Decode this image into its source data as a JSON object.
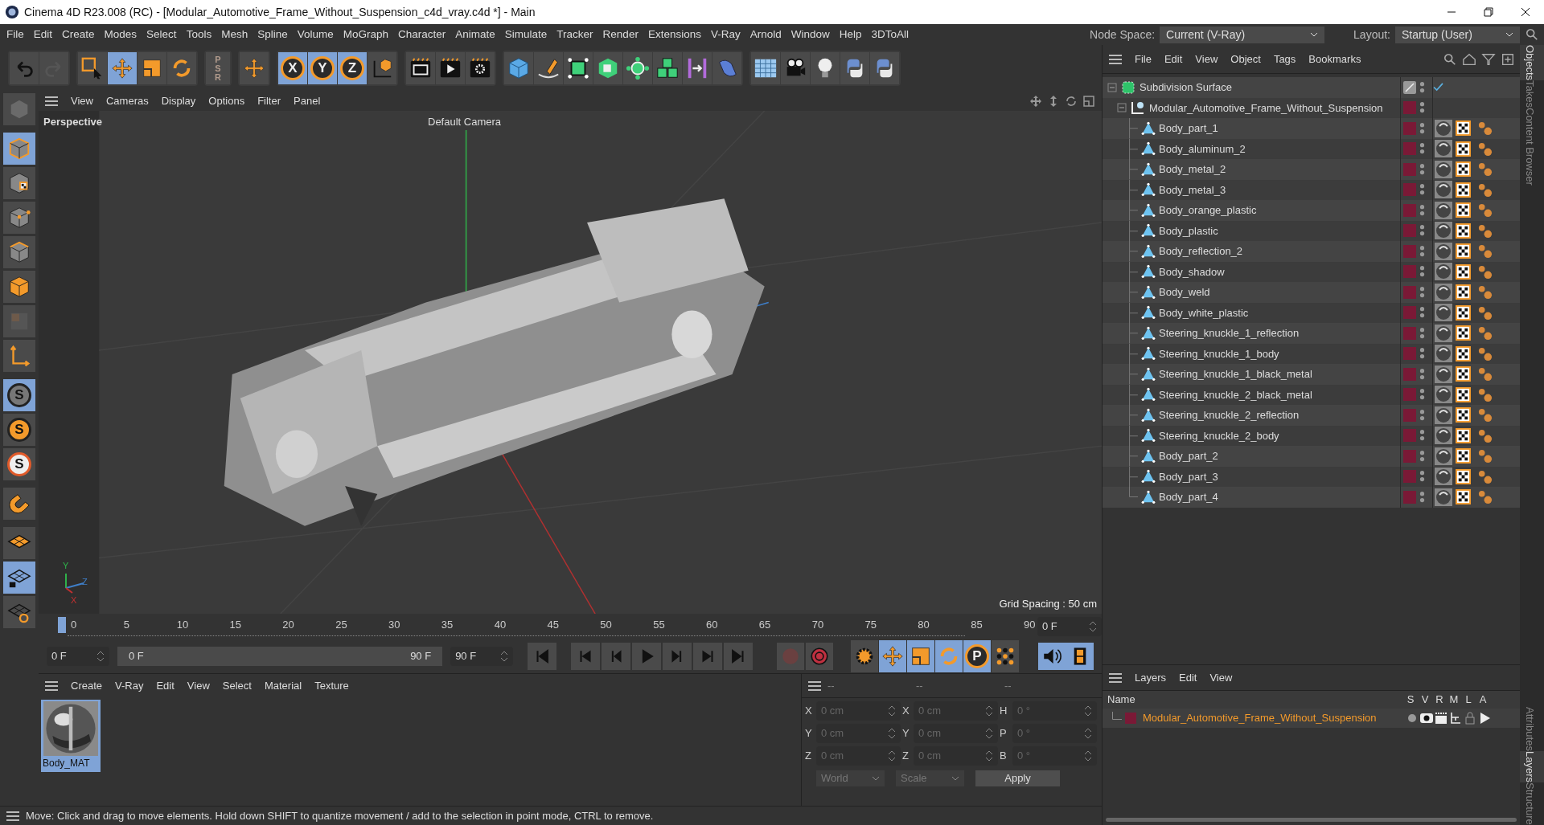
{
  "window": {
    "title": "Cinema 4D R23.008 (RC) - [Modular_Automotive_Frame_Without_Suspension_c4d_vray.c4d *] - Main"
  },
  "menu": [
    "File",
    "Edit",
    "Create",
    "Modes",
    "Select",
    "Tools",
    "Mesh",
    "Spline",
    "Volume",
    "MoGraph",
    "Character",
    "Animate",
    "Simulate",
    "Tracker",
    "Render",
    "Extensions",
    "V-Ray",
    "Arnold",
    "Window",
    "Help",
    "3DToAll"
  ],
  "node_space": {
    "label": "Node Space:",
    "value": "Current (V-Ray)"
  },
  "layout": {
    "label": "Layout:",
    "value": "Startup (User)"
  },
  "toolbar": [
    [
      {
        "kind": "undo",
        "selected": false
      },
      {
        "kind": "redo",
        "selected": false
      }
    ],
    [
      {
        "kind": "select",
        "selected": false
      },
      {
        "kind": "move",
        "selected": true
      },
      {
        "kind": "scale",
        "selected": false
      },
      {
        "kind": "rotate",
        "selected": false
      }
    ],
    [
      {
        "kind": "psr",
        "selected": false,
        "label": "PSR"
      }
    ],
    [
      {
        "kind": "move",
        "selected": false
      }
    ],
    [
      {
        "kind": "axis",
        "selected": true,
        "label": "X"
      },
      {
        "kind": "axis",
        "selected": true,
        "label": "Y"
      },
      {
        "kind": "axis",
        "selected": true,
        "label": "Z"
      },
      {
        "kind": "coord",
        "selected": false
      }
    ],
    [
      {
        "kind": "renderview",
        "selected": false
      },
      {
        "kind": "render",
        "selected": false
      },
      {
        "kind": "rendersettings",
        "selected": false
      }
    ],
    [
      {
        "kind": "cube",
        "selected": false
      },
      {
        "kind": "pen",
        "selected": false
      },
      {
        "kind": "subdivide",
        "selected": false
      },
      {
        "kind": "extrude",
        "selected": false
      },
      {
        "kind": "cloner",
        "selected": false
      },
      {
        "kind": "cubes",
        "selected": false
      },
      {
        "kind": "symmetry",
        "selected": false
      },
      {
        "kind": "deformer",
        "selected": false
      }
    ],
    [
      {
        "kind": "floor",
        "selected": false
      },
      {
        "kind": "camera",
        "selected": false
      },
      {
        "kind": "light",
        "selected": false
      },
      {
        "kind": "script",
        "selected": false
      },
      {
        "kind": "script",
        "selected": false
      }
    ]
  ],
  "left_tools": [
    {
      "kind": "model",
      "selected": false
    },
    {
      "kind": "object",
      "selected": true
    },
    {
      "kind": "texture",
      "selected": false
    },
    {
      "kind": "point",
      "selected": false
    },
    {
      "kind": "edge",
      "selected": false
    },
    {
      "kind": "polygon",
      "selected": false
    },
    {
      "kind": "uv",
      "selected": false
    },
    {
      "kind": "axis",
      "selected": false
    },
    {
      "kind": "snap",
      "selected": true,
      "label": "S"
    },
    {
      "kind": "snaporange",
      "selected": false,
      "label": "S"
    },
    {
      "kind": "snapwhite",
      "selected": false,
      "label": "S"
    },
    {
      "kind": "magnet",
      "selected": false
    },
    {
      "kind": "plane",
      "selected": false
    },
    {
      "kind": "planelock",
      "selected": true
    },
    {
      "kind": "planesync",
      "selected": false
    }
  ],
  "viewport": {
    "menu": [
      "View",
      "Cameras",
      "Display",
      "Options",
      "Filter",
      "Panel"
    ],
    "label": "Perspective",
    "camera": "Default Camera",
    "grid_spacing": "Grid Spacing : 50 cm",
    "axes": [
      "Y",
      "Z",
      "X"
    ]
  },
  "timeline": {
    "ticks": [
      "0",
      "5",
      "10",
      "15",
      "20",
      "25",
      "30",
      "35",
      "40",
      "45",
      "50",
      "55",
      "60",
      "65",
      "70",
      "75",
      "80",
      "85",
      "90"
    ],
    "frame_field": "0 F",
    "current_frame": "0 F",
    "range_start": "0 F",
    "range_end": "90 F",
    "end_field": "90 F",
    "key_modes": [
      {
        "kind": "gear",
        "selected": false
      },
      {
        "kind": "move",
        "selected": true
      },
      {
        "kind": "scale",
        "selected": true
      },
      {
        "kind": "rotate",
        "selected": true
      },
      {
        "kind": "param",
        "selected": true,
        "label": "P"
      },
      {
        "kind": "dots",
        "selected": false
      }
    ]
  },
  "materials": {
    "menu": [
      "Create",
      "V-Ray",
      "Edit",
      "View",
      "Select",
      "Material",
      "Texture"
    ],
    "items": [
      {
        "name": "Body_MAT",
        "selected": true
      }
    ]
  },
  "coordinates": {
    "headers": [
      "--",
      "--",
      "--"
    ],
    "rows": [
      {
        "pos_label": "X",
        "pos": "0 cm",
        "size_label": "X",
        "size": "0 cm",
        "rot_label": "H",
        "rot": "0 °"
      },
      {
        "pos_label": "Y",
        "pos": "0 cm",
        "size_label": "Y",
        "size": "0 cm",
        "rot_label": "P",
        "rot": "0 °"
      },
      {
        "pos_label": "Z",
        "pos": "0 cm",
        "size_label": "Z",
        "size": "0 cm",
        "rot_label": "B",
        "rot": "0 °"
      }
    ],
    "space": "World",
    "mode": "Scale",
    "apply": "Apply"
  },
  "status_bar": "Move: Click and drag to move elements. Hold down SHIFT to quantize movement / add to the selection in point mode, CTRL to remove.",
  "objects": {
    "menu": [
      "File",
      "Edit",
      "View",
      "Object",
      "Tags",
      "Bookmarks"
    ],
    "tree": [
      {
        "name": "Subdivision Surface",
        "expanded": true,
        "children": [
          {
            "name": "Modular_Automotive_Frame_Without_Suspension",
            "expanded": true,
            "children": [
              {
                "name": "Body_part_1"
              },
              {
                "name": "Body_aluminum_2"
              },
              {
                "name": "Body_metal_2"
              },
              {
                "name": "Body_metal_3"
              },
              {
                "name": "Body_orange_plastic"
              },
              {
                "name": "Body_plastic"
              },
              {
                "name": "Body_reflection_2"
              },
              {
                "name": "Body_shadow"
              },
              {
                "name": "Body_weld"
              },
              {
                "name": "Body_white_plastic"
              },
              {
                "name": "Steering_knuckle_1_reflection"
              },
              {
                "name": "Steering_knuckle_1_body"
              },
              {
                "name": "Steering_knuckle_1_black_metal"
              },
              {
                "name": "Steering_knuckle_2_black_metal"
              },
              {
                "name": "Steering_knuckle_2_reflection"
              },
              {
                "name": "Steering_knuckle_2_body"
              },
              {
                "name": "Body_part_2"
              },
              {
                "name": "Body_part_3"
              },
              {
                "name": "Body_part_4"
              }
            ]
          }
        ]
      }
    ]
  },
  "layers": {
    "menu": [
      "Layers",
      "Edit",
      "View"
    ],
    "columns": [
      "Name",
      "S",
      "V",
      "R",
      "M",
      "L",
      "A"
    ],
    "rows": [
      {
        "name": "Modular_Automotive_Frame_Without_Suspension"
      }
    ]
  },
  "side_tabs_top": [
    {
      "label": "Objects",
      "selected": true
    },
    {
      "label": "Takes",
      "selected": false
    },
    {
      "label": "Content Browser",
      "selected": false
    }
  ],
  "side_tabs_bottom": [
    {
      "label": "Attributes",
      "selected": false
    },
    {
      "label": "Layers",
      "selected": true
    },
    {
      "label": "Structure",
      "selected": false
    }
  ]
}
